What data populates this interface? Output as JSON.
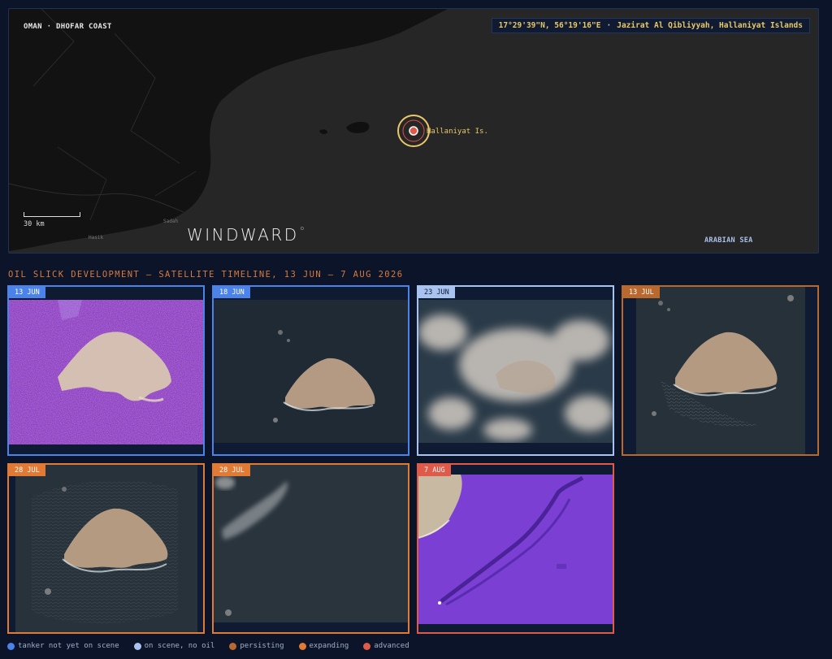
{
  "map": {
    "region_label": "OMAN · DHOFAR COAST",
    "coords": "17°29'39\"N, 56°19'16\"E",
    "place": "Jazirat Al Qibliyyah, Hallaniyat Islands",
    "marker_label": "Hallaniyat Is.",
    "scale_label": "30 km",
    "logo": "WINDWARD",
    "logo_mark": "o",
    "sea_label": "ARABIAN SEA",
    "towns": [
      "Sadah",
      "Hasik"
    ]
  },
  "timeline": {
    "title": "OIL SLICK DEVELOPMENT — SATELLITE TIMELINE, 13 JUN – 7 AUG 2026",
    "tiles": [
      {
        "date": "13 JUN",
        "status": "tanker not yet on scene"
      },
      {
        "date": "18 JUN",
        "status": "tanker not yet on scene"
      },
      {
        "date": "23 JUN",
        "status": "on scene, no oil"
      },
      {
        "date": "13 JUL",
        "status": "persisting"
      },
      {
        "date": "28 JUL",
        "status": "expanding"
      },
      {
        "date": "28 JUL",
        "status": "expanding"
      },
      {
        "date": "7 AUG",
        "status": "advanced"
      }
    ]
  },
  "legend": [
    {
      "label": "tanker not yet on scene",
      "color": "#4b83e8"
    },
    {
      "label": "on scene, no oil",
      "color": "#a8c3ef"
    },
    {
      "label": "persisting",
      "color": "#b9692e"
    },
    {
      "label": "expanding",
      "color": "#e07a35"
    },
    {
      "label": "advanced",
      "color": "#e05a4a"
    }
  ],
  "colors": {
    "background": "#0b1428",
    "accent_gold": "#e8c86a",
    "accent_orange": "#d97b3b"
  }
}
